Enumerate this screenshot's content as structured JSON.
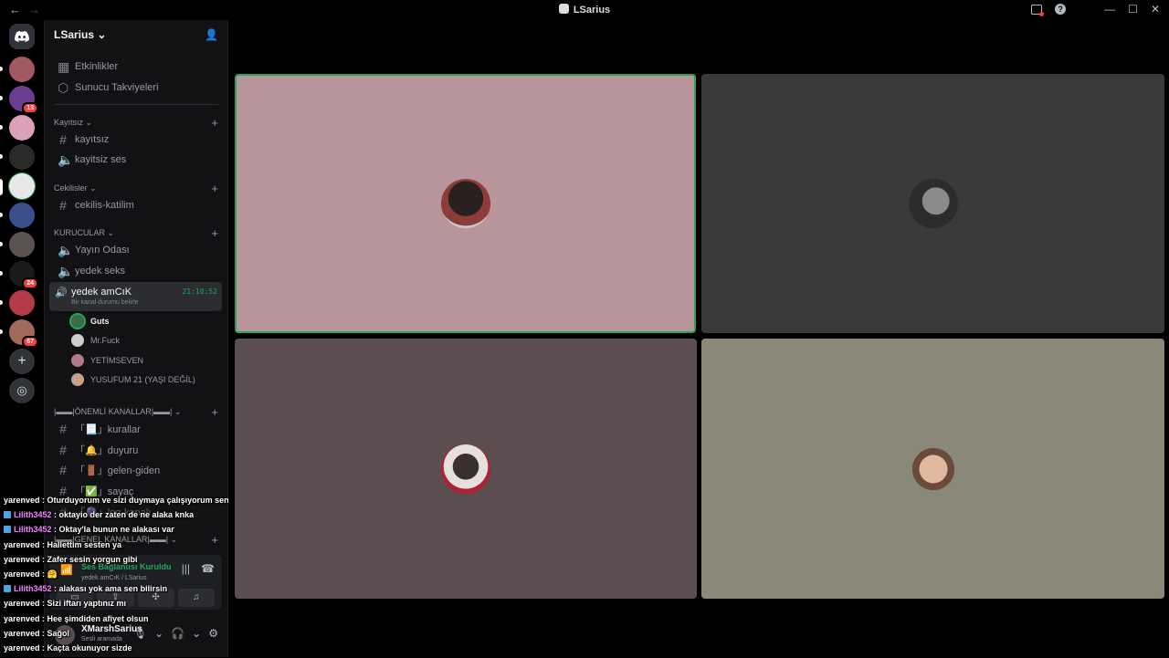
{
  "window": {
    "title": "LSarius",
    "back": "←",
    "forward": "→",
    "controls": [
      "—",
      "☐",
      "✕"
    ]
  },
  "rail": {
    "badges": [
      "13",
      "24",
      "67"
    ]
  },
  "sidebar": {
    "server_name": "LSarius",
    "top_items": [
      {
        "label": "Etkinlikler",
        "icon": "calendar-icon"
      },
      {
        "label": "Sunucu Takviyeleri",
        "icon": "boost-icon"
      }
    ],
    "categories": [
      {
        "label": "Kayıtsız"
      },
      {
        "label": "Cekilisler"
      },
      {
        "label": "KURUCULAR"
      },
      {
        "label": "|▬▬|ÖNEMLİ KANALLAR|▬▬|"
      },
      {
        "label": "|▬▬|GENEL KANALLAR|▬▬|"
      }
    ],
    "channels": [
      {
        "label": "kayıtsız",
        "type": "text"
      },
      {
        "label": "kayitsiz ses",
        "type": "voice"
      },
      {
        "label": "cekilis-katilim",
        "type": "text"
      },
      {
        "label": "Yayın Odası",
        "type": "voice"
      },
      {
        "label": "yedek seks",
        "type": "voice"
      },
      {
        "label": "「📃」kurallar",
        "type": "text"
      },
      {
        "label": "「🔔」duyuru",
        "type": "text"
      },
      {
        "label": "「🚪」gelen-giden",
        "type": "text"
      },
      {
        "label": "「✅」sayaç",
        "type": "text"
      },
      {
        "label": "「🔮」log-kanalı",
        "type": "text"
      }
    ],
    "active_voice": {
      "name": "yedek amCıK",
      "timer": "21:10:52",
      "status": "Bir kanal durumu belirle"
    },
    "members": [
      {
        "name": "Guts",
        "color": "#3b6b4a"
      },
      {
        "name": "Mr.Fuck",
        "color": "#cfcfcf"
      },
      {
        "name": "YETİMSEVEN",
        "color": "#b07a8a"
      },
      {
        "name": "YUSUFUM 21 (YAŞI DEĞİL)",
        "color": "#c9a08a"
      }
    ]
  },
  "voice_panel": {
    "title": "Ses Bağlantısı Kuruldu",
    "subtitle": "yedek amCıK / LSarius"
  },
  "user_panel": {
    "name": "XMarshSarius",
    "status": "Sesli aramada"
  },
  "overlay_chat": [
    {
      "user": "yarenved",
      "text": " : Oturduyorum ve sizi duymaya çalışıyorum sen",
      "platform": "plain"
    },
    {
      "user": "Lilith3452",
      "text": " : oktayio der zaten de ne alaka knka",
      "platform": "twitch"
    },
    {
      "user": "Lilith3452",
      "text": " : Oktay'la bunun ne alakası var",
      "platform": "twitch"
    },
    {
      "user": "yarenved",
      "text": " : Hallettim sesten ya",
      "platform": "plain"
    },
    {
      "user": "yarenved",
      "text": " : Zafer sesin yorgun gibi",
      "platform": "plain"
    },
    {
      "user": "yarenved",
      "text": " : 🤗",
      "platform": "plain"
    },
    {
      "user": "Lilith3452",
      "text": " : alakası yok ama sen bilirsin",
      "platform": "twitch"
    },
    {
      "user": "yarenved",
      "text": " : Sizi iftarı yaptınız mı",
      "platform": "plain"
    },
    {
      "user": "yarenved",
      "text": " : Hee şimdiden afiyet olsun",
      "platform": "plain"
    },
    {
      "user": "yarenved",
      "text": " : Sağol",
      "platform": "plain"
    },
    {
      "user": "yarenved",
      "text": " : Kaçta okunuyor sizde",
      "platform": "plain"
    }
  ],
  "tiles": [
    {
      "bg": "#b7959a",
      "speaking": true
    },
    {
      "bg": "#3a3a3a",
      "speaking": false
    },
    {
      "bg": "#5c4d51",
      "speaking": false
    },
    {
      "bg": "#8a8878",
      "speaking": false
    }
  ]
}
